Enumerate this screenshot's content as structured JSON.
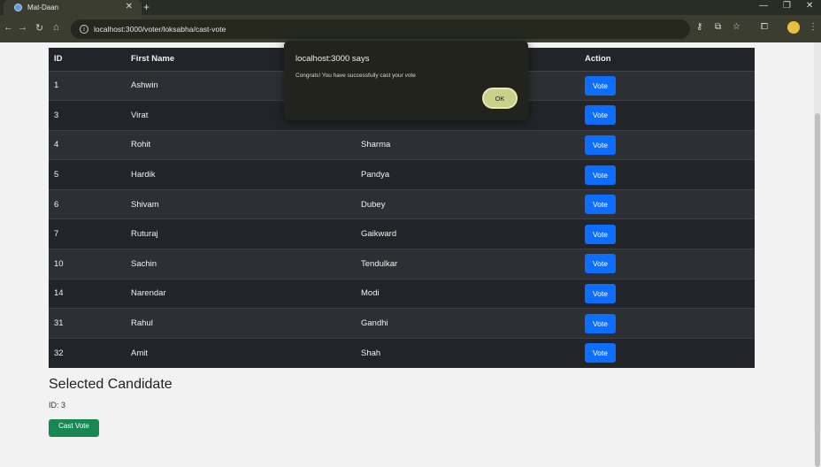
{
  "browser": {
    "tab_title": "Mat-Daan",
    "url": "localhost:3000/voter/loksabha/cast-vote"
  },
  "table": {
    "headers": [
      "ID",
      "First Name",
      "",
      "Action"
    ],
    "rows": [
      {
        "id": "1",
        "first": "Ashwin",
        "last": "",
        "action": "Vote"
      },
      {
        "id": "3",
        "first": "Virat",
        "last": "",
        "action": "Vote"
      },
      {
        "id": "4",
        "first": "Rohit",
        "last": "Sharma",
        "action": "Vote"
      },
      {
        "id": "5",
        "first": "Hardik",
        "last": "Pandya",
        "action": "Vote"
      },
      {
        "id": "6",
        "first": "Shivam",
        "last": "Dubey",
        "action": "Vote"
      },
      {
        "id": "7",
        "first": "Ruturaj",
        "last": "Gaikward",
        "action": "Vote"
      },
      {
        "id": "10",
        "first": "Sachin",
        "last": "Tendulkar",
        "action": "Vote"
      },
      {
        "id": "14",
        "first": "Narendar",
        "last": "Modi",
        "action": "Vote"
      },
      {
        "id": "31",
        "first": "Rahul",
        "last": "Gandhi",
        "action": "Vote"
      },
      {
        "id": "32",
        "first": "Amit",
        "last": "Shah",
        "action": "Vote"
      }
    ]
  },
  "selected": {
    "title": "Selected Candidate",
    "id_text": "ID: 3",
    "cast_label": "Cast Vote"
  },
  "alert": {
    "title": "localhost:3000 says",
    "message": "Congrats! You have successfully cast your vote",
    "ok_label": "OK"
  },
  "colors": {
    "vote_button": "#0d6efd",
    "cast_button": "#198754",
    "table_dark": "#212529"
  }
}
